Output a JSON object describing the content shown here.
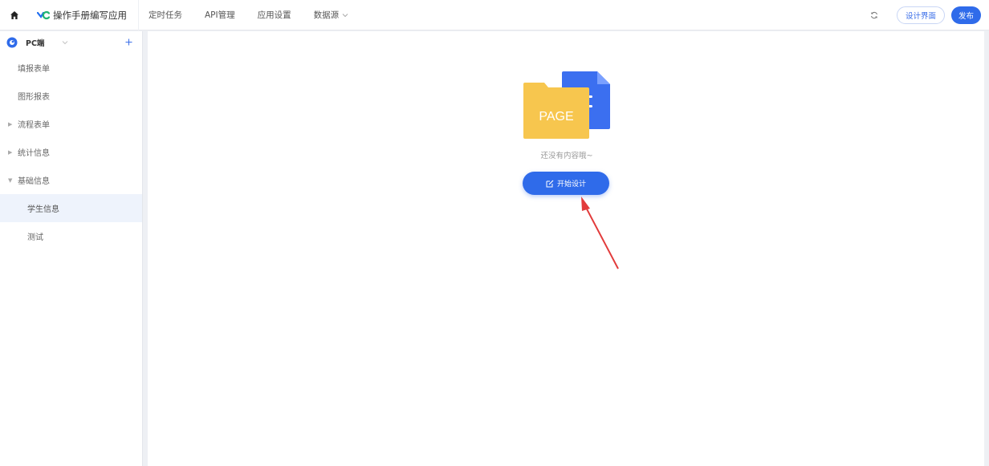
{
  "header": {
    "app_name": "操作手册编写应用",
    "nav": [
      {
        "label": "定时任务"
      },
      {
        "label": "API管理"
      },
      {
        "label": "应用设置"
      },
      {
        "label": "数据源"
      }
    ],
    "design_label": "设计界面",
    "publish_label": "发布"
  },
  "sidebar": {
    "title": "PC端",
    "items": [
      {
        "label": "填报表单"
      },
      {
        "label": "图形报表"
      },
      {
        "label": "流程表单"
      },
      {
        "label": "统计信息"
      },
      {
        "label": "基础信息"
      },
      {
        "label": "学生信息"
      },
      {
        "label": "测试"
      }
    ]
  },
  "main": {
    "illustration_text": "PAGE",
    "empty_text": "还没有内容哦~",
    "start_label": "开始设计"
  },
  "colors": {
    "accent": "#2f6bea",
    "folder": "#f7c64e",
    "doc": "#3b6ff0",
    "arrow": "#e23b3b"
  }
}
